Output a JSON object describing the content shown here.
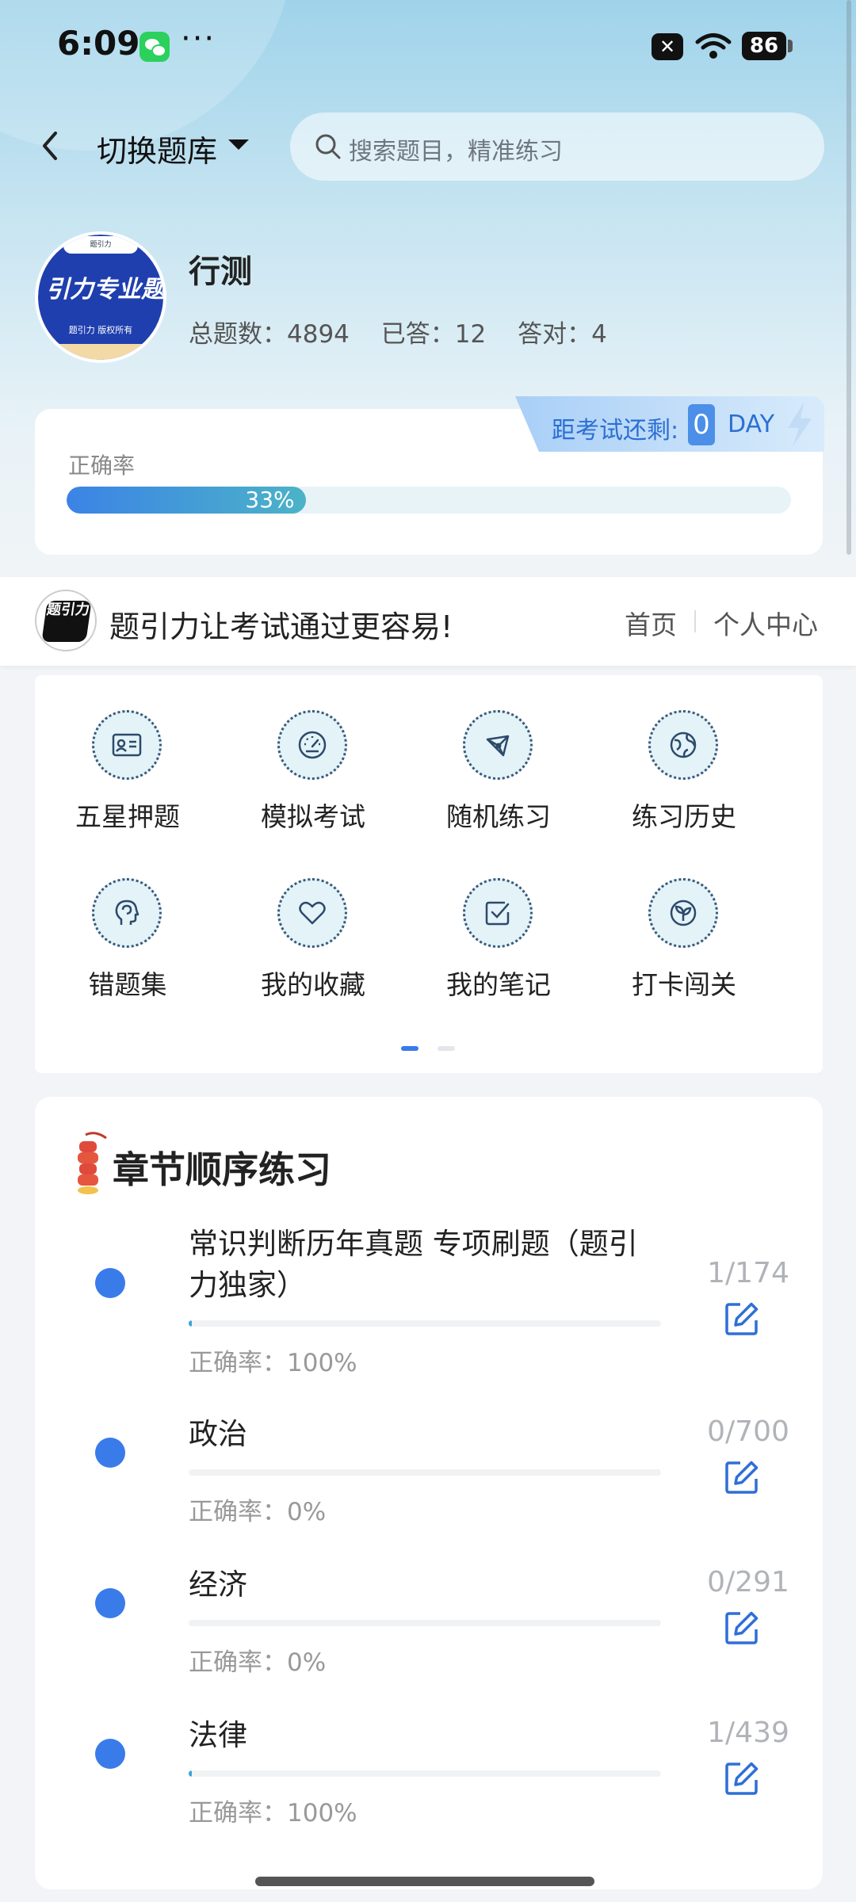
{
  "status_bar": {
    "time": "6:09",
    "more": "···",
    "battery": "86"
  },
  "header": {
    "switch_bank_label": "切换题库",
    "search_placeholder": "搜索题目，精准练习"
  },
  "profile": {
    "avatar_top_text": "题引力",
    "avatar_main_text": "引力专业题",
    "avatar_sub_text": "题引力 版权所有",
    "subject": "行测",
    "total_label": "总题数：4894",
    "answered_label": "已答：12",
    "correct_label": "答对：4"
  },
  "accuracy": {
    "label": "正确率",
    "percent_text": "33%",
    "fraction": 0.33,
    "countdown_label": "距考试还剩:",
    "countdown_value": "0",
    "countdown_unit": "DAY"
  },
  "banner": {
    "logo_text": "题引力",
    "slogan": "题引力让考试通过更容易!",
    "home_link": "首页",
    "profile_link": "个人中心"
  },
  "menu": {
    "items": [
      {
        "label": "五星押题",
        "icon": "id-card-icon"
      },
      {
        "label": "模拟考试",
        "icon": "gauge-icon"
      },
      {
        "label": "随机练习",
        "icon": "network-icon"
      },
      {
        "label": "练习历史",
        "icon": "globe-icon"
      },
      {
        "label": "错题集",
        "icon": "head-icon"
      },
      {
        "label": "我的收藏",
        "icon": "heart-icon"
      },
      {
        "label": "我的笔记",
        "icon": "note-check-icon"
      },
      {
        "label": "打卡闯关",
        "icon": "sprout-icon"
      }
    ],
    "page_indicator": {
      "current": 1,
      "total": 2
    }
  },
  "chapters": {
    "title": "章节顺序练习",
    "items": [
      {
        "name": "常识判断历年真题 专项刷题（题引力独家）",
        "accuracy": "正确率：100%",
        "count": "1/174",
        "progress": 0.0057
      },
      {
        "name": "政治",
        "accuracy": "正确率：0%",
        "count": "0/700",
        "progress": 0
      },
      {
        "name": "经济",
        "accuracy": "正确率：0%",
        "count": "0/291",
        "progress": 0
      },
      {
        "name": "法律",
        "accuracy": "正确率：100%",
        "count": "1/439",
        "progress": 0.0023
      }
    ]
  },
  "colors": {
    "accent": "#3a7bea",
    "progress_gradient_start": "#3b83e6",
    "progress_gradient_end": "#4cb3c7",
    "wechat_green": "#2bd15c"
  }
}
